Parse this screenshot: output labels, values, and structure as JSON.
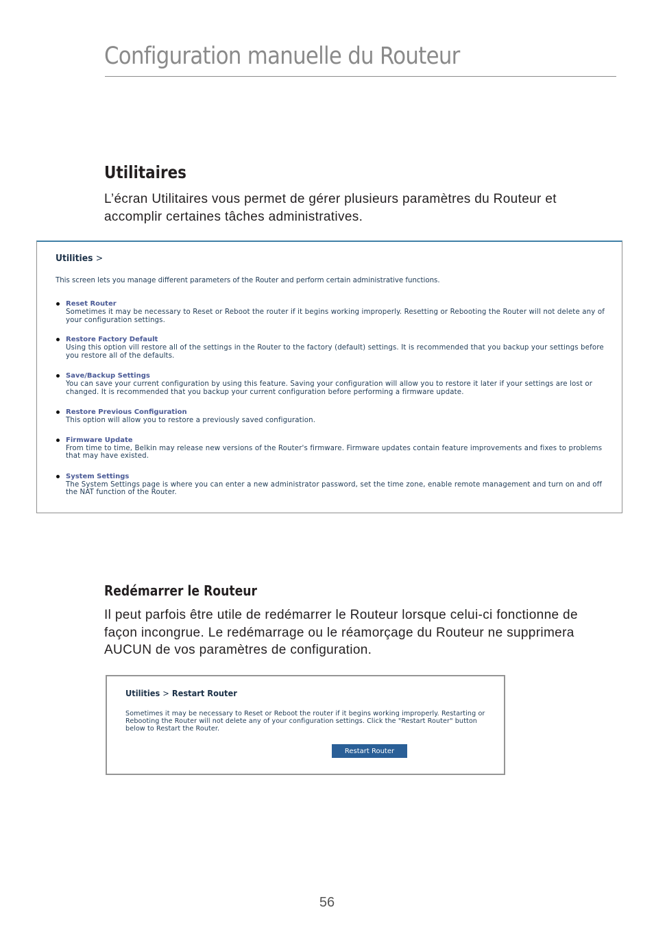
{
  "header": {
    "title": "Configuration manuelle du Routeur"
  },
  "section_utilities": {
    "heading": "Utilitaires",
    "paragraph": "L’écran Utilitaires vous permet de gérer plusieurs paramètres du Routeur et accomplir certaines tâches administratives."
  },
  "utilities_screen": {
    "breadcrumb": {
      "label": "Utilities",
      "separator": ">"
    },
    "intro": "This screen lets you manage different parameters of the Router and perform certain administrative functions.",
    "items": [
      {
        "label": "Reset Router",
        "description": "Sometimes it may be necessary to Reset or Reboot the router if it begins working improperly. Resetting or Rebooting the Router will not delete any of your configuration settings."
      },
      {
        "label": "Restore Factory Default",
        "description": "Using this option vill restore all of the settings in the Router to the factory (default) settings. It is recommended that you backup your settings before you restore all of the defaults."
      },
      {
        "label": "Save/Backup Settings",
        "description": "You can save your current configuration by using this feature. Saving your configuration will allow you to restore it later if your settings are lost or changed. It is recommended that you backup your current configuration before performing a firmware update."
      },
      {
        "label": "Restore Previous Configuration",
        "description": "This option will allow you to restore a previously saved configuration."
      },
      {
        "label": "Firmware Update",
        "description": "From time to time, Belkin may release new versions of the Router's firmware. Firmware updates contain feature improvements and fixes to problems that may have existed."
      },
      {
        "label": "System Settings",
        "description": "The System Settings page is where you can enter a new administrator password, set the time zone, enable remote management and turn on and off the NAT function of the Router."
      }
    ]
  },
  "section_restart": {
    "heading": "Redémarrer le Routeur",
    "paragraph": "Il peut parfois être utile de redémarrer le Routeur lorsque celui-ci fonctionne de façon incongrue. Le redémarrage ou le réamorçage du Routeur ne supprimera AUCUN de vos paramètres de configuration."
  },
  "restart_screen": {
    "breadcrumb": {
      "parent": "Utilities",
      "separator": ">",
      "current": "Restart Router"
    },
    "description": "Sometimes it may be necessary to Reset or Reboot the router if it begins working improperly. Restarting or Rebooting the Router will not delete any of your configuration settings. Click the \"Restart Router\" button below to Restart the Router.",
    "button_label": "Restart Router",
    "button_color": "#2a5f97"
  },
  "footer": {
    "page_number": "56"
  }
}
